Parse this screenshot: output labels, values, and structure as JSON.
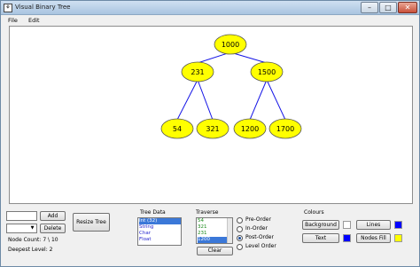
{
  "window": {
    "title": "Visual Binary Tree",
    "app_icon": "tree-app-icon",
    "minimize": "–",
    "maximize": "□",
    "close": "✕"
  },
  "menu": {
    "items": [
      "File",
      "Edit"
    ]
  },
  "tree": {
    "nodes": [
      {
        "label": "1000"
      },
      {
        "label": "231"
      },
      {
        "label": "1500"
      },
      {
        "label": "54"
      },
      {
        "label": "321"
      },
      {
        "label": "1200"
      },
      {
        "label": "1700"
      }
    ],
    "colors": {
      "background": "#ffffff",
      "lines": "#1414e6",
      "node_fill": "#ffff00",
      "node_stroke": "#555555"
    }
  },
  "controls": {
    "value_input": "",
    "add_label": "Add",
    "type_select": "",
    "delete_label": "Delete",
    "resize_label": "Resize Tree",
    "node_count": "Node Count: 7 \\ 10",
    "deepest_level": "Deepest Level: 2"
  },
  "tree_data": {
    "title": "Tree Data",
    "items": [
      "Int (32)",
      "String",
      "Char",
      "Float"
    ],
    "selected_index": 0
  },
  "traverse": {
    "title": "Traverse",
    "items": [
      "54",
      "321",
      "231",
      "1200"
    ],
    "selected_index": 3,
    "clear_label": "Clear",
    "options": [
      "Pre-Order",
      "In-Order",
      "Post-Order",
      "Level Order"
    ],
    "checked_index": 2
  },
  "colours": {
    "title": "Colours",
    "background_label": "Background",
    "lines_label": "Lines",
    "text_label": "Text",
    "nodes_fill_label": "Nodes Fill",
    "background_color": "#ffffff",
    "lines_color": "#0000ff",
    "text_color": "#0000ff",
    "nodes_fill_color": "#ffff00"
  }
}
